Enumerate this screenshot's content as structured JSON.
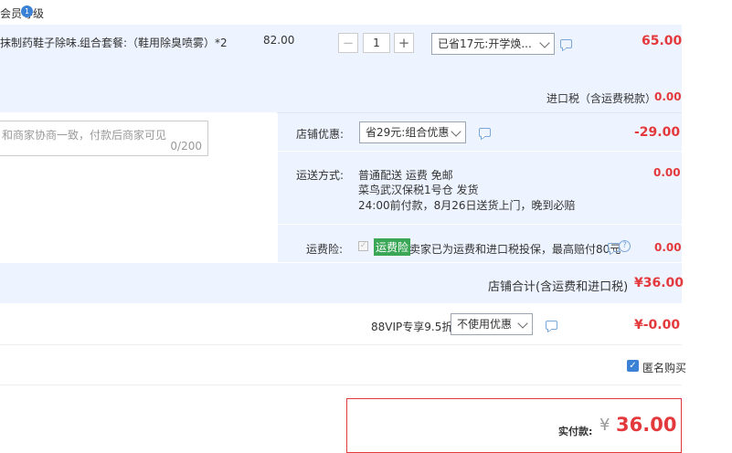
{
  "header": {
    "level_text": "会员等级",
    "badge_text": "1"
  },
  "item": {
    "name": "抹制药鞋子除味...",
    "spec": "组合套餐:（鞋用除臭喷雾）*2",
    "price": "82.00",
    "quantity": "1",
    "promo_select": "已省17元:开学焕...",
    "subtotal": "65.00"
  },
  "tax": {
    "label": "进口税（含运费税款）",
    "value": "0.00"
  },
  "message": {
    "placeholder": "和商家协商一致，付款后商家可见",
    "counter": "0/200"
  },
  "shop_discount": {
    "label": "店铺优惠:",
    "select": "省29元:组合优惠",
    "value": "-29.00"
  },
  "shipping": {
    "label": "运送方式:",
    "line1": "普通配送 运费 免邮",
    "line2": "菜鸟武汉保税1号仓   发货",
    "line3": "24:00前付款，8月26日送货上门，晚到必赔",
    "value": "0.00"
  },
  "insurance": {
    "label": "运费险:",
    "tag": "运费险",
    "text": "卖家已为运费和进口税投保，最高赔付80元",
    "value": "0.00"
  },
  "shop_total": {
    "label": "店铺合计(含运费和进口税)",
    "value": "¥36.00"
  },
  "vip": {
    "label": "88VIP专享9.5折",
    "select": "不使用优惠",
    "value": "¥-0.00"
  },
  "anonymous": {
    "label": "匿名购买",
    "checked": true
  },
  "payment": {
    "label": "实付款:",
    "currency": "¥",
    "amount": "36.00"
  },
  "colors": {
    "accent_red": "#e4393c",
    "band_blue": "#eef4ff",
    "tag_green": "#3aa757",
    "check_blue": "#3b82d6"
  }
}
